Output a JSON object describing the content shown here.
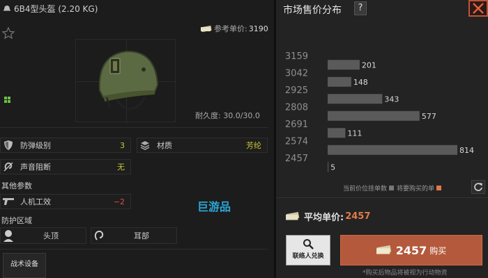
{
  "item": {
    "title": "6B4型头盔 (2.20 KG)",
    "ref_price_label": "参考单价:",
    "ref_price_value": "3190",
    "durability": "耐久度: 30.0/30.0"
  },
  "stats": {
    "armor_class": {
      "label": "防弹级别",
      "value": "3"
    },
    "material": {
      "label": "材质",
      "value": "芳纶"
    },
    "noise_reduction": {
      "label": "声音阻断",
      "value": "无"
    },
    "other_params": "其他参数",
    "ergonomics": {
      "label": "人机工效",
      "value": "−2"
    },
    "protection_zone": "防护区域",
    "zone_head": "头顶",
    "zone_ears": "耳部",
    "tactical": "战术设备"
  },
  "watermark": "巨游品",
  "market": {
    "title": "市场售价分布",
    "help": "?",
    "legend_current": "当前价位挂单数",
    "legend_buy": "将要购买的单",
    "avg_label": "平均单价:",
    "avg_value": "2457",
    "alt_button": "联络人兑换",
    "buy_price": "2457",
    "buy_label": "购买",
    "note": "*购买后物品将被视为行动物资"
  },
  "colors": {
    "accent_orange": "#e07a4a",
    "buy_button": "#b4593c",
    "value_green": "#c8c83a",
    "value_red": "#e0503a",
    "bar": "#5a5a5a"
  },
  "chart_data": {
    "type": "bar",
    "orientation": "horizontal",
    "categories": [
      "3159",
      "3042",
      "2925",
      "2808",
      "2691",
      "2574",
      "2457"
    ],
    "values": [
      null,
      201,
      148,
      343,
      577,
      111,
      814,
      5
    ],
    "bars": [
      {
        "price": "3042",
        "count": 201
      },
      {
        "price": "2925",
        "count": 148
      },
      {
        "price": "2808",
        "count": 343
      },
      {
        "price": "2691",
        "count": 577
      },
      {
        "price": "2574",
        "count": 111
      },
      {
        "price": "2457",
        "count": 814
      },
      {
        "price": "2457",
        "count": 5
      }
    ],
    "xlim": [
      0,
      814
    ]
  }
}
